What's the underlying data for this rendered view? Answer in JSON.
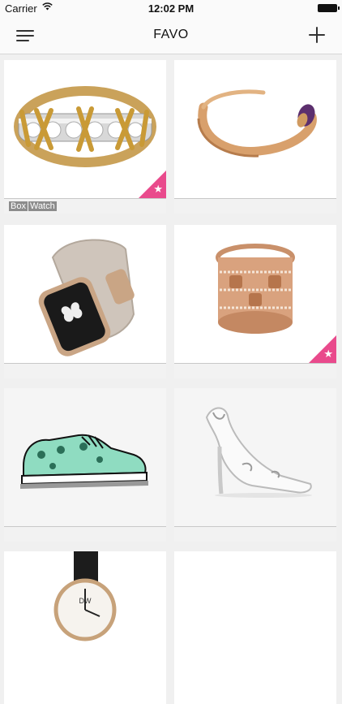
{
  "status_bar": {
    "carrier": "Carrier",
    "time": "12:02 PM"
  },
  "nav": {
    "title": "FAVO",
    "menu_icon": "hamburger-menu-icon",
    "add_icon": "plus-icon"
  },
  "colors": {
    "favorite_badge": "#e94a8c"
  },
  "items": [
    {
      "name": "diamond-ring-with-gold-x",
      "favorite": true,
      "tags": [
        "Box",
        "Watch"
      ]
    },
    {
      "name": "rose-gold-cuff-bracelet",
      "favorite": false,
      "tags": []
    },
    {
      "name": "smartwatch-with-leather-strap",
      "favorite": false,
      "tags": []
    },
    {
      "name": "rose-gold-diamond-ring",
      "favorite": true,
      "tags": []
    },
    {
      "name": "mint-floral-sneaker",
      "favorite": false,
      "tags": []
    },
    {
      "name": "white-ornate-stiletto-heel",
      "favorite": false,
      "tags": []
    },
    {
      "name": "classic-wristwatch",
      "favorite": false,
      "tags": []
    },
    {
      "name": "empty-item",
      "favorite": false,
      "tags": []
    }
  ]
}
